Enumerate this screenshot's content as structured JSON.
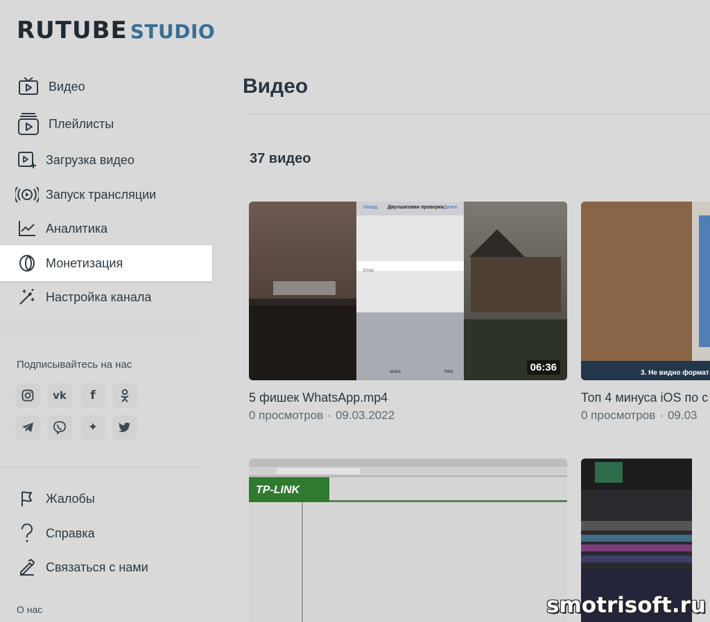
{
  "logo": {
    "main": "RUTUBE",
    "sub": "STUDIO"
  },
  "sidebar": {
    "items": [
      {
        "label": "Видео",
        "icon": "tv-play-icon"
      },
      {
        "label": "Плейлисты",
        "icon": "playlist-icon"
      },
      {
        "label": "Загрузка видео",
        "icon": "upload-video-icon"
      },
      {
        "label": "Запуск трансляции",
        "icon": "broadcast-icon"
      },
      {
        "label": "Аналитика",
        "icon": "analytics-icon"
      },
      {
        "label": "Монетизация",
        "icon": "monetization-icon",
        "active": true
      },
      {
        "label": "Настройка канала",
        "icon": "magic-wand-icon"
      }
    ],
    "social_title": "Подписывайтесь на нас",
    "social": [
      "instagram-icon",
      "vk-icon",
      "facebook-icon",
      "odnoklassniki-icon",
      "telegram-icon",
      "viber-icon",
      "sparkle-icon",
      "twitter-icon"
    ],
    "social_glyphs": {
      "vk": "vk",
      "facebook": "f",
      "sparkle": "✦"
    },
    "footer_items": [
      {
        "label": "Жалобы",
        "icon": "flag-icon"
      },
      {
        "label": "Справка",
        "icon": "help-icon"
      },
      {
        "label": "Связаться с нами",
        "icon": "contact-icon"
      }
    ],
    "about": "О нас"
  },
  "main": {
    "title": "Видео",
    "count": "37 видео",
    "videos": [
      {
        "title": "5 фишек WhatsApp.mp4",
        "views": "0 просмотров",
        "date": "09.03.2022",
        "duration": "06:36"
      },
      {
        "title": "Топ 4 минуса iOS по с",
        "views": "0 просмотров",
        "date": "09.03",
        "duration": ""
      },
      {
        "title": "",
        "views": "",
        "date": "",
        "duration": ""
      },
      {
        "title": "",
        "views": "",
        "date": "",
        "duration": ""
      }
    ],
    "thumb_texts": {
      "back": "Назад",
      "screen_title": "Двухшаговая проверка",
      "done": "Далее",
      "email": "Email",
      "space": "space",
      "next": "Next",
      "tplink": "TP-LINK",
      "caption2": "3. Не видно формат"
    }
  },
  "watermark": "smotrisoft.ru",
  "colors": {
    "background": "#d9d9d9",
    "brand_dark": "#1f2a33",
    "brand_blue": "#3a6e95",
    "active_bg": "#ffffff"
  }
}
